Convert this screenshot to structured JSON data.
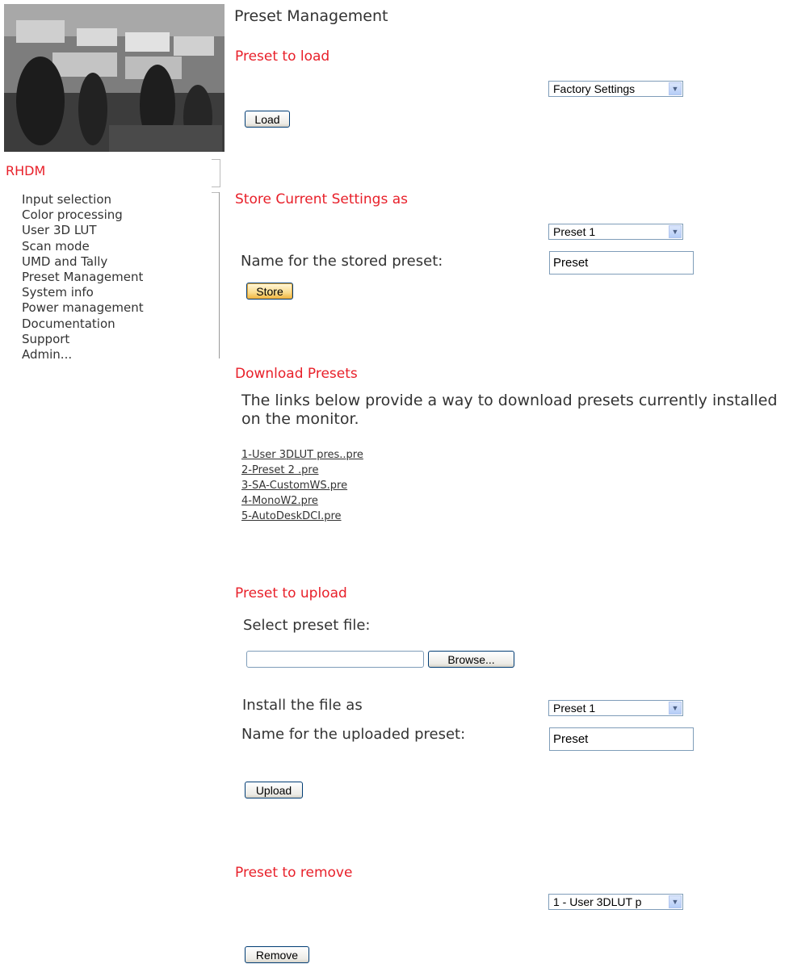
{
  "page": {
    "title": "Preset Management"
  },
  "brand": "RHDM",
  "nav": {
    "items": [
      "Input selection",
      "Color processing",
      "User 3D LUT",
      "Scan mode",
      "UMD and Tally",
      "Preset Management",
      "System info",
      "Power management",
      "Documentation",
      "Support",
      "Admin..."
    ]
  },
  "load_section": {
    "title": "Preset to load",
    "select_value": "Factory Settings",
    "button": "Load"
  },
  "store_section": {
    "title": "Store Current Settings as",
    "select_value": "Preset 1",
    "name_label": "Name for the stored preset:",
    "name_value": "Preset",
    "button": "Store"
  },
  "download_section": {
    "title": "Download Presets",
    "description": "The links below provide a way to download presets currently installed on the monitor.",
    "links": [
      "1-User 3DLUT pres..pre",
      "2-Preset 2  .pre",
      "3-SA-CustomWS.pre",
      "4-MonoW2.pre",
      "5-AutoDeskDCI.pre"
    ]
  },
  "upload_section": {
    "title": "Preset to upload",
    "select_file_label": "Select preset file:",
    "browse_button": "Browse...",
    "install_label": "Install the file as",
    "install_select_value": "Preset 1",
    "name_label": "Name for the uploaded preset:",
    "name_value": "Preset",
    "button": "Upload"
  },
  "remove_section": {
    "title": "Preset to remove",
    "select_value": "1 - User 3DLUT p",
    "button": "Remove"
  },
  "icons": {
    "dropdown": "chevron-down-icon"
  },
  "colors": {
    "accent": "#e8202a",
    "text": "#333333"
  }
}
